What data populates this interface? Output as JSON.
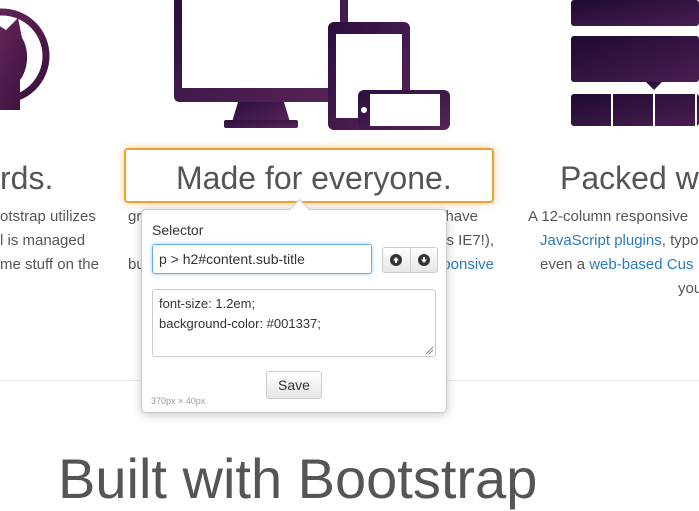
{
  "page": {
    "left_col": {
      "heading": "rds.",
      "lines": [
        "otstrap utilizes",
        "l is managed",
        "me stuff on the"
      ]
    },
    "middle_col": {
      "heading": "Made for everyone.",
      "lines": [
        {
          "pre": "gr",
          "post": "have"
        },
        {
          "pre": "",
          "post": "s IE7!),"
        },
        {
          "pre": "bu",
          "link": "ponsive"
        }
      ]
    },
    "right_col": {
      "heading": "Packed wi",
      "line1": "A 12-column responsive",
      "line2_link": "JavaScript plugins",
      "line2_rest": ", typo",
      "line3_pre": "even a ",
      "line3_link": "web-based Cus",
      "line4": "you"
    },
    "section_title": "Built with Bootstrap"
  },
  "popover": {
    "label": "Selector",
    "selector_value": "p > h2#content.sub-title",
    "css_lines": [
      "font-size: 1.2em;",
      "background-color: #001337;"
    ],
    "save_label": "Save",
    "dimensions": "370px × 40px"
  },
  "colors": {
    "illustration": "#2a0f3e",
    "highlight": "#f0a030",
    "link": "#2a7ac0"
  }
}
